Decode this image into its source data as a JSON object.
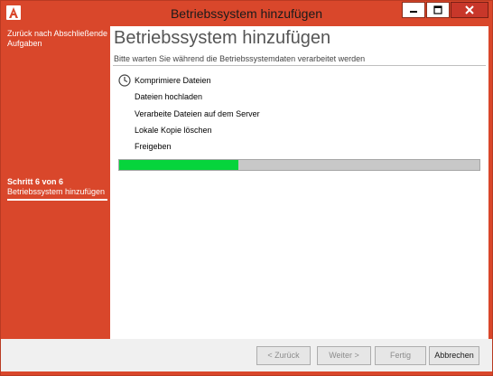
{
  "window": {
    "title": "Betriebssystem hinzufügen"
  },
  "sidebar": {
    "back_label": "Zurück nach Abschließende Aufgaben",
    "step_count": "Schritt 6 von 6",
    "step_name": "Betriebssystem hinzufügen"
  },
  "main": {
    "title": "Betriebssystem hinzufügen",
    "subtitle": "Bitte warten Sie während die Betriebssystemdaten verarbeitet werden",
    "tasks": [
      {
        "label": "Komprimiere Dateien",
        "status": "in-progress",
        "icon": "clock-icon"
      },
      {
        "label": "Dateien hochladen",
        "status": "pending"
      },
      {
        "label": "Verarbeite Dateien auf dem Server",
        "status": "pending"
      },
      {
        "label": "Lokale Kopie löschen",
        "status": "pending"
      },
      {
        "label": "Freigeben",
        "status": "pending"
      }
    ],
    "progress_fraction": 0.33
  },
  "footer": {
    "back_button": "< Zurück",
    "next_button": "Weiter >",
    "finish_button": "Fertig",
    "cancel_button": "Abbrechen"
  },
  "colors": {
    "accent": "#d9472b",
    "progress": "#06d43c",
    "progress_track": "#c8c8c8"
  }
}
